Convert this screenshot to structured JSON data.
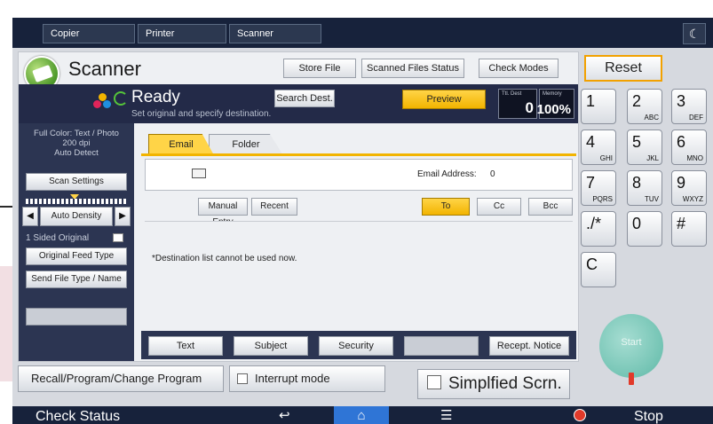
{
  "top_tabs": [
    "Copier",
    "Printer",
    "Scanner"
  ],
  "top_right_icon": "moon-icon",
  "app": {
    "title": "Scanner"
  },
  "header_buttons": {
    "store_file": "Store File",
    "scanned_files_status": "Scanned Files Status",
    "check_modes": "Check Modes"
  },
  "status": {
    "text": "Ready",
    "subtext": "Set original and specify destination.",
    "search_dest": "Search Dest.",
    "preview": "Preview",
    "dest_counter_label": "Ttl. Dest",
    "dest_counter_value": "0",
    "memory_label": "Memory",
    "memory_value": "100%"
  },
  "left_panel": {
    "info_line1": "Full Color: Text / Photo",
    "info_line2": "200 dpi",
    "info_line3": "Auto Detect",
    "scan_settings": "Scan Settings",
    "auto_density": "Auto Density",
    "sided_original": "1 Sided Original",
    "original_feed_type": "Original Feed Type",
    "send_file_type": "Send File Type / Name"
  },
  "destination": {
    "tabs": [
      "Email",
      "Folder"
    ],
    "email_address_label": "Email Address:",
    "email_address_count": "0",
    "manual_entry": "Manual Entry",
    "recent": "Recent",
    "to": "To",
    "cc": "Cc",
    "bcc": "Bcc",
    "message": "*Destination list cannot be used now."
  },
  "bottom_buttons": {
    "text": "Text",
    "subject": "Subject",
    "security": "Security",
    "recept_notice": "Recept. Notice"
  },
  "lower_row": {
    "recall": "Recall/Program/Change Program",
    "interrupt": "Interrupt mode",
    "simplified": "Simplfied Scrn."
  },
  "keypad": {
    "reset": "Reset",
    "keys": [
      {
        "num": "1",
        "sub": ""
      },
      {
        "num": "2",
        "sub": "ABC"
      },
      {
        "num": "3",
        "sub": "DEF"
      },
      {
        "num": "4",
        "sub": "GHI"
      },
      {
        "num": "5",
        "sub": "JKL"
      },
      {
        "num": "6",
        "sub": "MNO"
      },
      {
        "num": "7",
        "sub": "PQRS"
      },
      {
        "num": "8",
        "sub": "TUV"
      },
      {
        "num": "9",
        "sub": "WXYZ"
      },
      {
        "num": "./*",
        "sub": ""
      },
      {
        "num": "0",
        "sub": ""
      },
      {
        "num": "#",
        "sub": ""
      },
      {
        "num": "C",
        "sub": ""
      }
    ],
    "start": "Start"
  },
  "bottom_nav": {
    "check_status": "Check Status",
    "stop": "Stop"
  },
  "colors": {
    "accent": "#f2b400",
    "header_dark": "#232a48",
    "home_tab": "#2f75d6",
    "start": "#74c4b4",
    "stop": "#e13a2a"
  }
}
